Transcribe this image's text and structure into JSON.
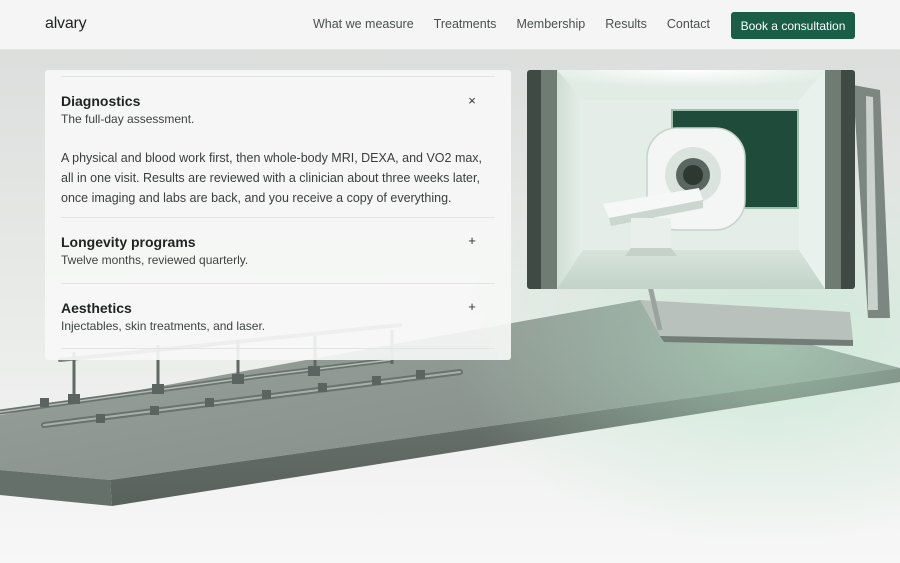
{
  "header": {
    "logo": "alvary",
    "nav": [
      "What we measure",
      "Treatments",
      "Membership",
      "Results",
      "Contact"
    ],
    "cta_label": "Book a consultation"
  },
  "accordion": {
    "items": [
      {
        "title": "Diagnostics",
        "subtitle": "The full-day assessment.",
        "toggle": "×",
        "body": "A physical and blood work first, then whole-body MRI, DEXA, and VO2 max, all in one visit. Results are reviewed with a clinician about three weeks later, once imaging and labs are back, and you receive a copy of everything."
      },
      {
        "title": "Longevity programs",
        "subtitle": "Twelve months, reviewed quarterly.",
        "toggle": "+"
      },
      {
        "title": "Aesthetics",
        "subtitle": "Injectables, skin treatments, and laser.",
        "toggle": "+"
      }
    ]
  },
  "colors": {
    "accent": "#1b5e47",
    "page_background": "#f4f5f4",
    "platform": "#8f9893"
  },
  "icons": {
    "close": "close-icon",
    "expand": "plus-icon"
  }
}
